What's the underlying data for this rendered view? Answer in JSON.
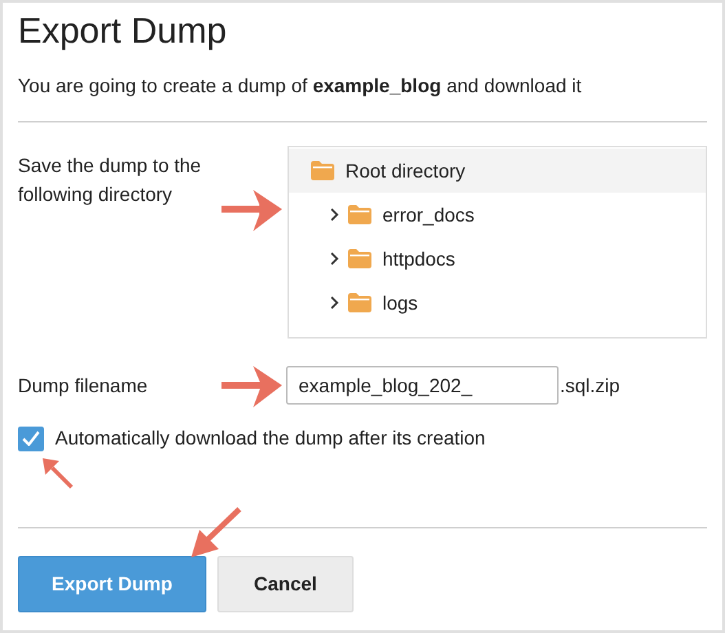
{
  "dialog": {
    "title": "Export Dump",
    "description": "You are going to create a dump of **example_blog** and download it"
  },
  "directory": {
    "label": "Save the dump to the following directory",
    "tree": {
      "label": "Root directory",
      "selected": true,
      "children": [
        {
          "label": "error_docs",
          "selected": false,
          "expanded": false
        },
        {
          "label": "httpdocs",
          "selected": false,
          "expanded": false
        },
        {
          "label": "logs",
          "selected": false,
          "expanded": false
        }
      ]
    }
  },
  "filename": {
    "label": "Dump filename",
    "value": "example_blog_202_",
    "suffix": ".sql.zip"
  },
  "auto_download": {
    "label": "Automatically download the dump after its creation",
    "checked": true
  },
  "buttons": [
    {
      "label": "Export Dump",
      "kind": "primary"
    },
    {
      "label": "Cancel",
      "kind": "secondary"
    }
  ]
}
